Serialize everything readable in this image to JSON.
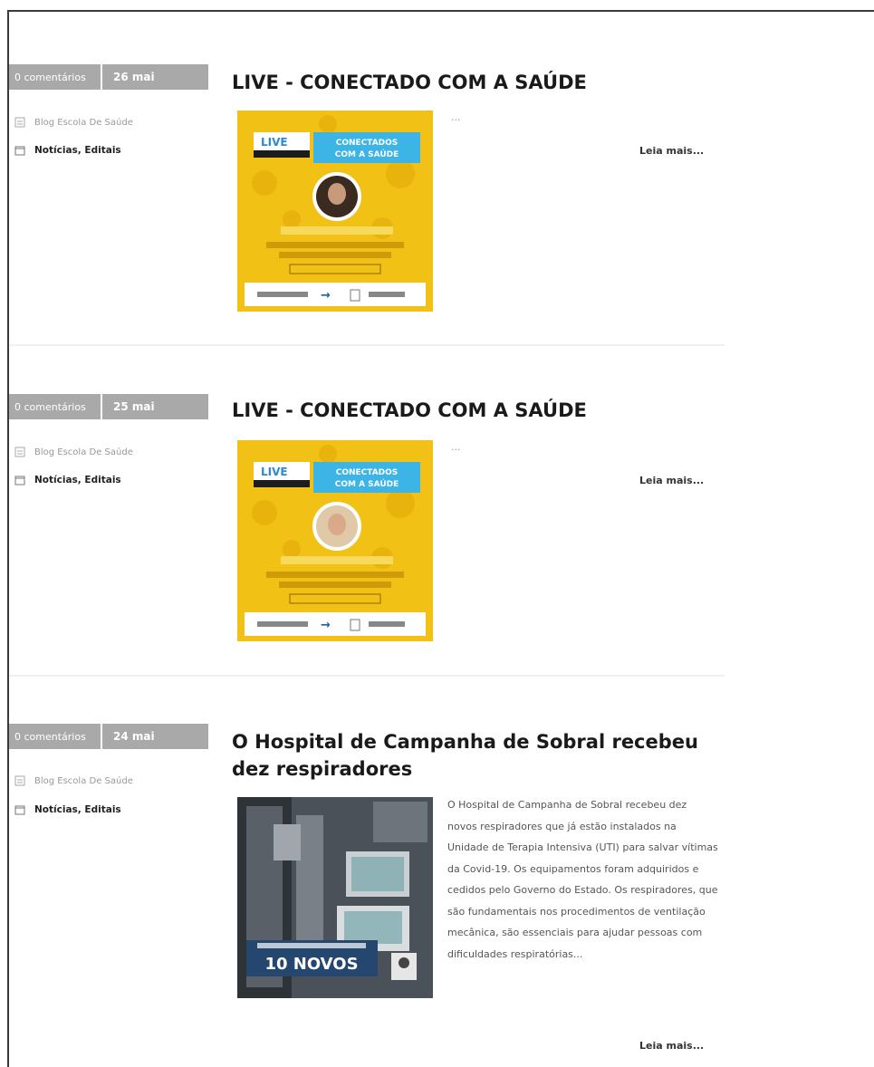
{
  "posts": [
    {
      "comments": "0 comentários",
      "date": "26 mai",
      "author": "Blog Escola De Saúde",
      "categories": "Notícias, Editais",
      "title": "LIVE - CONECTADO COM A SAÚDE",
      "excerpt": "...",
      "read_more": "Leia mais...",
      "card": {
        "badge": "LIVE",
        "headline_1": "CONECTADOS",
        "headline_2": "COM A SAÚDE",
        "accent": "#f3c317",
        "secondary": "#3cb4e5"
      }
    },
    {
      "comments": "0 comentários",
      "date": "25 mai",
      "author": "Blog Escola De Saúde",
      "categories": "Notícias, Editais",
      "title": "LIVE - CONECTADO COM A SAÚDE",
      "excerpt": "...",
      "read_more": "Leia mais...",
      "card": {
        "badge": "LIVE",
        "headline_1": "CONECTADOS",
        "headline_2": "COM A SAÚDE",
        "accent": "#f3c317",
        "secondary": "#3cb4e5"
      }
    },
    {
      "comments": "0 comentários",
      "date": "24 mai",
      "author": "Blog Escola De Saúde",
      "categories": "Notícias, Editais",
      "title": "O Hospital de Campanha de Sobral recebeu dez respiradores",
      "excerpt": "O Hospital de Campanha de Sobral recebeu dez novos respiradores que já estão instalados na Unidade de Terapia Intensiva (UTI) para salvar vítimas da Covid-19. Os equipamentos foram adquiridos e cedidos pelo Governo do Estado. Os respiradores, que são fundamentais nos procedimentos de ventilação mecânica, são essenciais para ajudar pessoas com dificuldades respiratórias...",
      "read_more": "Leia mais...",
      "photo_banner": "10 NOVOS"
    }
  ]
}
